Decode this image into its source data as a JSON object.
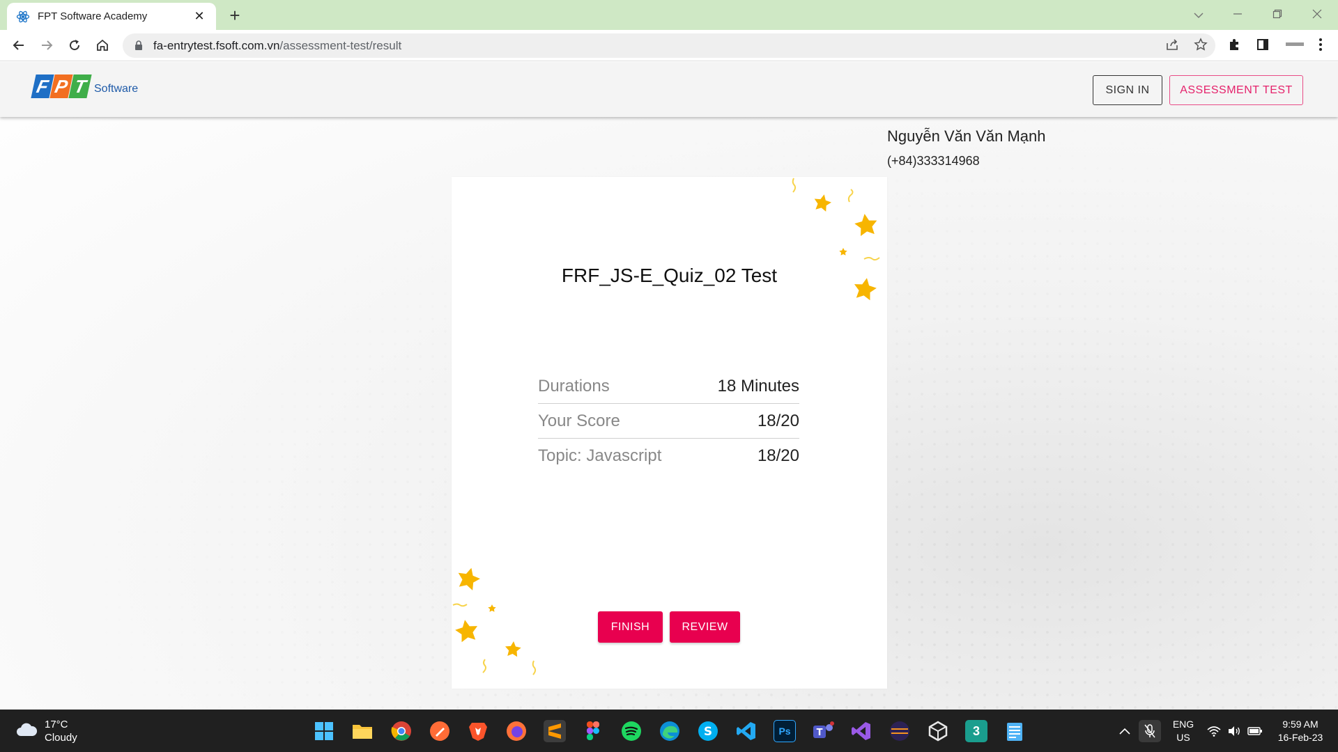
{
  "browser": {
    "tab_title": "FPT Software Academy",
    "tab_close": "✕",
    "new_tab": "+",
    "url_host": "fa-entrytest.fsoft.com.vn",
    "url_path": "/assessment-test/result"
  },
  "header": {
    "logo_letters": [
      "F",
      "P",
      "T"
    ],
    "logo_text": "Software",
    "sign_in": "SIGN IN",
    "assessment_test": "ASSESSMENT TEST"
  },
  "user": {
    "name": "Nguyễn Văn Văn Mạnh",
    "phone": "(+84)333314968"
  },
  "result": {
    "title": "FRF_JS-E_Quiz_02 Test",
    "rows": [
      {
        "label": "Durations",
        "value": "18 Minutes"
      },
      {
        "label": "Your Score",
        "value": "18/20"
      },
      {
        "label": "Topic: Javascript",
        "value": "18/20"
      }
    ]
  },
  "actions": {
    "finish": "FINISH",
    "review": "REVIEW"
  },
  "taskbar": {
    "temperature": "17°C",
    "condition": "Cloudy",
    "language": "ENG",
    "region": "US",
    "time": "9:59 AM",
    "date": "16-Feb-23",
    "apps": [
      "windows-start",
      "file-explorer",
      "chrome",
      "postman",
      "brave",
      "firefox",
      "sublime-text",
      "figma",
      "spotify",
      "edge",
      "skype",
      "vscode",
      "photoshop",
      "teams",
      "visual-studio",
      "eclipse",
      "unity",
      "3ds",
      "notepad"
    ]
  },
  "colors": {
    "accent": "#e8004f",
    "tab_strip": "#cfe8c5",
    "star": "#f7b500"
  }
}
